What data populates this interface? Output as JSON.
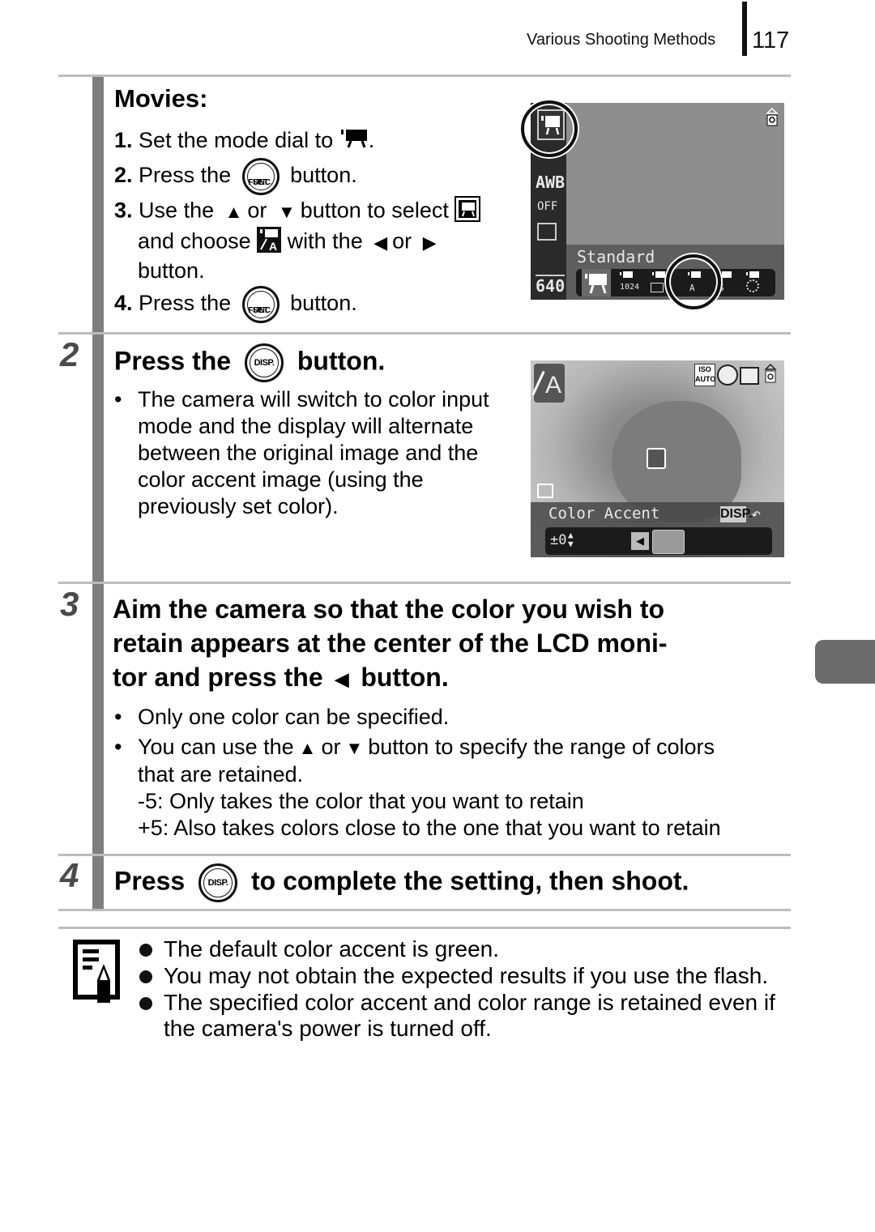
{
  "header": {
    "section": "Various Shooting Methods",
    "page_number": "117"
  },
  "movies": {
    "title": "Movies:",
    "steps": [
      {
        "num": "1.",
        "parts": [
          "Set the mode dial to",
          "."
        ],
        "icon": "movie-mode-icon"
      },
      {
        "num": "2.",
        "parts": [
          "Press the",
          "button."
        ],
        "button": "FUNC. SET"
      },
      {
        "num": "3.",
        "lines": [
          "Use the",
          "or",
          "button to select",
          "and choose",
          "with the",
          "or",
          "button."
        ]
      },
      {
        "num": "4.",
        "parts": [
          "Press the",
          "button."
        ],
        "button": "FUNC. SET"
      }
    ],
    "func_button": {
      "top": "FUNC.",
      "bottom": "SET"
    }
  },
  "lcd1": {
    "left_icons": [
      "AWB",
      "OFF",
      "640"
    ],
    "label": "Standard",
    "menu_items": [
      "Standard",
      "1024",
      "Postcard",
      "Color Accent",
      "Color Swap",
      "Time Lapse"
    ],
    "sub_labels": [
      "1024",
      "A",
      "S"
    ]
  },
  "step2": {
    "number": "2",
    "title_pre": "Press the",
    "title_post": "button.",
    "button": "DISP.",
    "bullets": [
      "The camera will switch to color input mode and the display will alternate between the original image and the color accent image (using the previously set color)."
    ],
    "bullet_lines": [
      "The camera will switch to color input",
      "mode and the display will alternate",
      "between the original image and the",
      "color accent image (using the",
      "previously set color)."
    ]
  },
  "lcd2": {
    "label": "Color Accent",
    "disp_label": "DISP.",
    "value": "±0",
    "iso_top": "ISO",
    "iso_bottom": "AUTO",
    "mode_letter": "A"
  },
  "step3": {
    "number": "3",
    "title_lines": [
      "Aim the camera so that the color you wish to",
      "retain appears at the center of the LCD moni-",
      "tor and press the",
      "button."
    ],
    "bullets": [
      "Only one color can be specified.",
      "You can use the",
      "or",
      "button to specify the range of colors",
      "that are retained."
    ],
    "range_notes": [
      "-5: Only takes the color that you want to retain",
      "+5: Also takes colors close to the one that you want to retain"
    ]
  },
  "step4": {
    "number": "4",
    "title_pre": "Press",
    "title_post": "to complete the setting, then shoot.",
    "button": "DISP."
  },
  "notes": {
    "icon": "memo-pencil-icon",
    "items": [
      "The default color accent is green.",
      "You may not obtain the expected results if you use the flash.",
      "The specified color accent and color range is retained even if",
      "the camera's power is turned off."
    ]
  },
  "arrows": {
    "up": "▲",
    "down": "▼",
    "left": "◀",
    "right": "▶"
  }
}
